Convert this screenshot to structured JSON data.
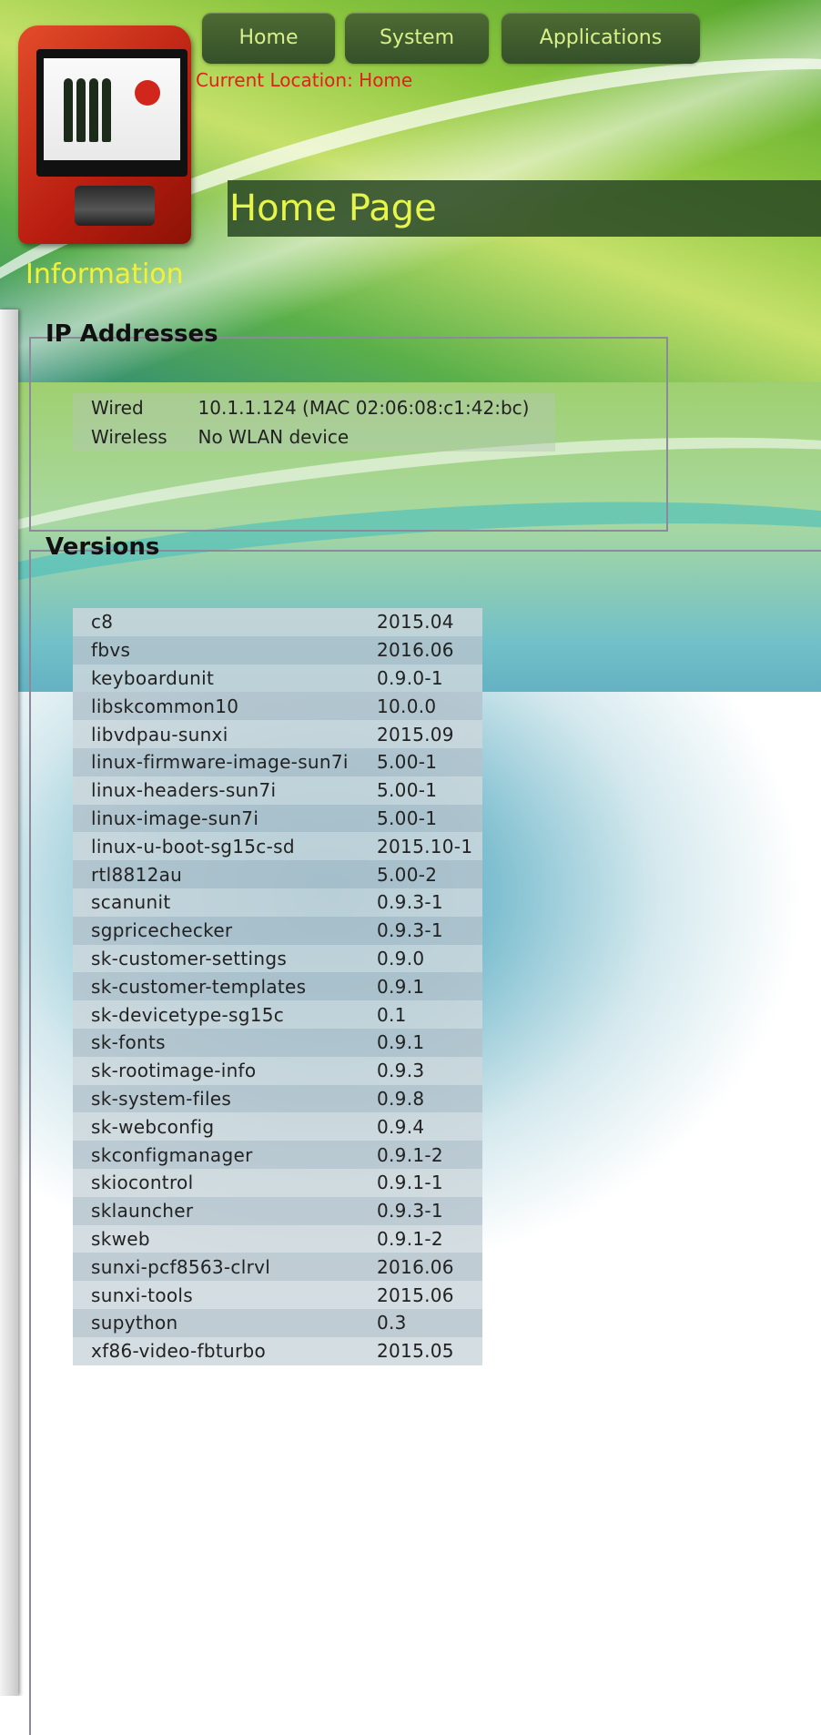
{
  "nav": {
    "buttons": [
      "Home",
      "System",
      "Applications"
    ]
  },
  "location": "Current Location: Home",
  "page_title": "Home Page",
  "section_heading": "Information",
  "ip_addresses": {
    "legend": "IP Addresses",
    "rows": [
      {
        "label": "Wired",
        "value": "10.1.1.124 (MAC 02:06:08:c1:42:bc)"
      },
      {
        "label": "Wireless",
        "value": "No WLAN device"
      }
    ]
  },
  "versions": {
    "legend": "Versions",
    "rows": [
      {
        "name": "c8",
        "version": "2015.04"
      },
      {
        "name": "fbvs",
        "version": "2016.06"
      },
      {
        "name": "keyboardunit",
        "version": "0.9.0-1"
      },
      {
        "name": "libskcommon10",
        "version": "10.0.0"
      },
      {
        "name": "libvdpau-sunxi",
        "version": "2015.09"
      },
      {
        "name": "linux-firmware-image-sun7i",
        "version": "5.00-1"
      },
      {
        "name": "linux-headers-sun7i",
        "version": "5.00-1"
      },
      {
        "name": "linux-image-sun7i",
        "version": "5.00-1"
      },
      {
        "name": "linux-u-boot-sg15c-sd",
        "version": "2015.10-1"
      },
      {
        "name": "rtl8812au",
        "version": "5.00-2"
      },
      {
        "name": "scanunit",
        "version": "0.9.3-1"
      },
      {
        "name": "sgpricechecker",
        "version": "0.9.3-1"
      },
      {
        "name": "sk-customer-settings",
        "version": "0.9.0"
      },
      {
        "name": "sk-customer-templates",
        "version": "0.9.1"
      },
      {
        "name": "sk-devicetype-sg15c",
        "version": "0.1"
      },
      {
        "name": "sk-fonts",
        "version": "0.9.1"
      },
      {
        "name": "sk-rootimage-info",
        "version": "0.9.3"
      },
      {
        "name": "sk-system-files",
        "version": "0.9.8"
      },
      {
        "name": "sk-webconfig",
        "version": "0.9.4"
      },
      {
        "name": "skconfigmanager",
        "version": "0.9.1-2"
      },
      {
        "name": "skiocontrol",
        "version": "0.9.1-1"
      },
      {
        "name": "sklauncher",
        "version": "0.9.3-1"
      },
      {
        "name": "skweb",
        "version": "0.9.1-2"
      },
      {
        "name": "sunxi-pcf8563-clrvl",
        "version": "2016.06"
      },
      {
        "name": "sunxi-tools",
        "version": "2015.06"
      },
      {
        "name": "supython",
        "version": "0.3"
      },
      {
        "name": "xf86-video-fbturbo",
        "version": "2015.05"
      }
    ]
  }
}
